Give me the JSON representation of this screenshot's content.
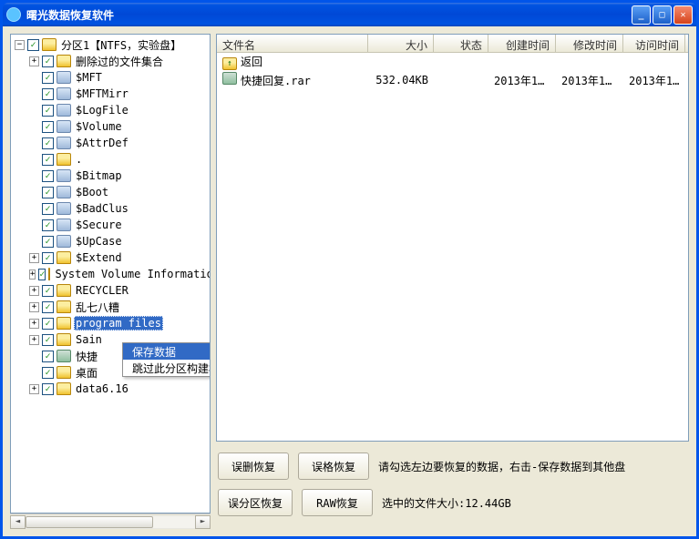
{
  "window": {
    "title": "曙光数据恢复软件"
  },
  "titlebar_buttons": {
    "min": "_",
    "max": "□",
    "close": "✕"
  },
  "tree": {
    "root": {
      "label": "分区1【NTFS，实验盘】",
      "items": [
        {
          "label": "删除过的文件集合",
          "exp": "+",
          "icon": "folder"
        },
        {
          "label": "$MFT",
          "exp": "",
          "icon": "sys"
        },
        {
          "label": "$MFTMirr",
          "exp": "",
          "icon": "sys"
        },
        {
          "label": "$LogFile",
          "exp": "",
          "icon": "sys"
        },
        {
          "label": "$Volume",
          "exp": "",
          "icon": "sys"
        },
        {
          "label": "$AttrDef",
          "exp": "",
          "icon": "sys"
        },
        {
          "label": ".",
          "exp": "",
          "icon": "folder"
        },
        {
          "label": "$Bitmap",
          "exp": "",
          "icon": "sys"
        },
        {
          "label": "$Boot",
          "exp": "",
          "icon": "sys"
        },
        {
          "label": "$BadClus",
          "exp": "",
          "icon": "sys"
        },
        {
          "label": "$Secure",
          "exp": "",
          "icon": "sys"
        },
        {
          "label": "$UpCase",
          "exp": "",
          "icon": "sys"
        },
        {
          "label": "$Extend",
          "exp": "+",
          "icon": "folder"
        },
        {
          "label": "System Volume Information",
          "exp": "+",
          "icon": "folder"
        },
        {
          "label": "RECYCLER",
          "exp": "+",
          "icon": "folder"
        },
        {
          "label": "乱七八糟",
          "exp": "+",
          "icon": "folder"
        },
        {
          "label": "program files",
          "exp": "+",
          "icon": "folder",
          "focused": true
        },
        {
          "label": "Sain",
          "exp": "+",
          "icon": "folder"
        },
        {
          "label": "快捷",
          "exp": "",
          "icon": "table"
        },
        {
          "label": "桌面",
          "exp": "",
          "icon": "folder"
        },
        {
          "label": "data6.16",
          "exp": "+",
          "icon": "folder"
        }
      ]
    }
  },
  "context_menu": {
    "items": [
      {
        "label": "保存数据",
        "selected": true
      },
      {
        "label": "跳过此分区构建树",
        "selected": false
      }
    ]
  },
  "file_list": {
    "columns": {
      "name": "文件名",
      "size": "大小",
      "status": "状态",
      "ctime": "创建时间",
      "mtime": "修改时间",
      "atime": "访问时间"
    },
    "up_label": "返回",
    "rows": [
      {
        "name": "快捷回复.rar",
        "size": "532.04KB",
        "status": "",
        "ctime": "2013年10...",
        "mtime": "2013年10...",
        "atime": "2013年10..."
      }
    ]
  },
  "buttons": {
    "row1": {
      "b1": "误删恢复",
      "b2": "误格恢复"
    },
    "row2": {
      "b1": "误分区恢复",
      "b2": "RAW恢复"
    }
  },
  "info": {
    "line1": "请勾选左边要恢复的数据，右击-保存数据到其他盘",
    "line2_prefix": "选中的文件大小:",
    "line2_value": "12.44GB"
  },
  "scroll": {
    "left": "◄",
    "right": "►"
  }
}
